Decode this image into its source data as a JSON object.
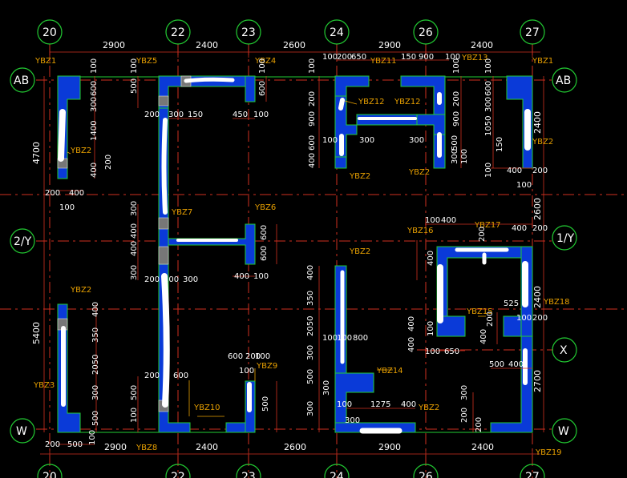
{
  "grid": {
    "axes_top": [
      "20",
      "22",
      "23",
      "24",
      "26",
      "27"
    ],
    "axes_bottom": [
      "20",
      "22",
      "23",
      "24",
      "26",
      "27"
    ],
    "axes_left": [
      "AB",
      "2/Y",
      "W"
    ],
    "axes_right": [
      "AB",
      "1/Y",
      "X",
      "W"
    ]
  },
  "dims_top": [
    "2900",
    "2400",
    "2600",
    "2900",
    "2400"
  ],
  "dims_bottom": [
    "2900",
    "2400",
    "2600",
    "2900",
    "2400"
  ],
  "dims_left": [
    "4700",
    "5400"
  ],
  "dims_right": [
    "2400",
    "2600",
    "2400",
    "2700"
  ],
  "colors": {
    "wall": "#0a3ad8",
    "outline": "#22cc33",
    "axis": "#d03020",
    "label": "#e8a000"
  },
  "labels": {
    "ybz1_l": "YBZ1",
    "ybz5": "YBZ5",
    "ybz4": "YBZ4",
    "ybz11": "YBZ11",
    "ybz13": "YBZ13",
    "ybz1_r": "YBZ1",
    "ybz2_a": "YBZ2",
    "ybz12_a": "YBZ12",
    "ybz12_b": "YBZ12",
    "ybz2_b": "YBZ2",
    "ybz2_c": "YBZ2",
    "ybz2_d": "YBZ2",
    "ybz7": "YBZ7",
    "ybz6": "YBZ6",
    "ybz16": "YBZ16",
    "ybz17": "YBZ17",
    "ybz2_e": "YBZ2",
    "ybz2_f": "YBZ2",
    "ybz18": "YBZ18",
    "ybz15": "YBZ15",
    "ybz3": "YBZ3",
    "ybz9": "YBZ9",
    "ybz14": "YBZ14",
    "ybz10": "YBZ10",
    "ybz8": "YBZ8",
    "ybz2_g": "YBZ2",
    "ybz19": "YBZ19"
  },
  "small_dims": {
    "a1": "100",
    "a2": "600",
    "a3": "300",
    "a4": "1400",
    "a5": "400",
    "a6": "200",
    "a7": "200",
    "a8": "400",
    "a9": "100",
    "b1": "100",
    "b2": "500",
    "b3": "200",
    "b4": "300",
    "b5": "150",
    "c1": "100",
    "c2": "600",
    "c3": "450",
    "c4": "100",
    "d1": "100",
    "d2": "200",
    "d3": "650",
    "d4": "150",
    "d5": "900",
    "d6": "100",
    "e1": "100",
    "e2": "200",
    "e3": "900",
    "e4": "600",
    "e5": "400",
    "e6": "100",
    "e7": "300",
    "f1": "100",
    "f2": "200",
    "f3": "900",
    "f4": "300",
    "f5": "500",
    "f6": "300",
    "f7": "100",
    "g1": "100",
    "g2": "600",
    "g3": "300",
    "g4": "1050",
    "g5": "150",
    "g6": "100",
    "g7": "400",
    "g8": "200",
    "g9": "100",
    "h1": "300",
    "h2": "400",
    "h3": "400",
    "h4": "300",
    "h5": "200",
    "h6": "100",
    "h7": "300",
    "i1": "600",
    "i2": "600",
    "i3": "400",
    "i4": "100",
    "j1": "100",
    "j2": "400",
    "j3": "200",
    "j4": "400",
    "j5": "200",
    "j6": "400",
    "k1": "400",
    "k2": "350",
    "k3": "2050",
    "k4": "300",
    "k5": "500",
    "k6": "100",
    "k7": "100",
    "k8": "800",
    "k9": "300",
    "l1": "400",
    "l2": "350",
    "l3": "2050",
    "l4": "300",
    "l5": "500",
    "l6": "200",
    "l7": "500",
    "l8": "100",
    "m1": "100",
    "m2": "400",
    "m3": "400",
    "m4": "650",
    "m5": "525",
    "m6": "100",
    "m7": "200",
    "n1": "400",
    "n2": "100",
    "n3": "500",
    "n4": "400",
    "n5": "200",
    "o1": "200",
    "o2": "600",
    "o3": "600",
    "o4": "100",
    "o5": "100",
    "p1": "100",
    "p2": "1275",
    "p3": "400",
    "p4": "300",
    "p5": "300",
    "p6": "200",
    "p7": "500",
    "p8": "300",
    "p9": "200",
    "q1": "200",
    "q2": "500",
    "q3": "100"
  }
}
